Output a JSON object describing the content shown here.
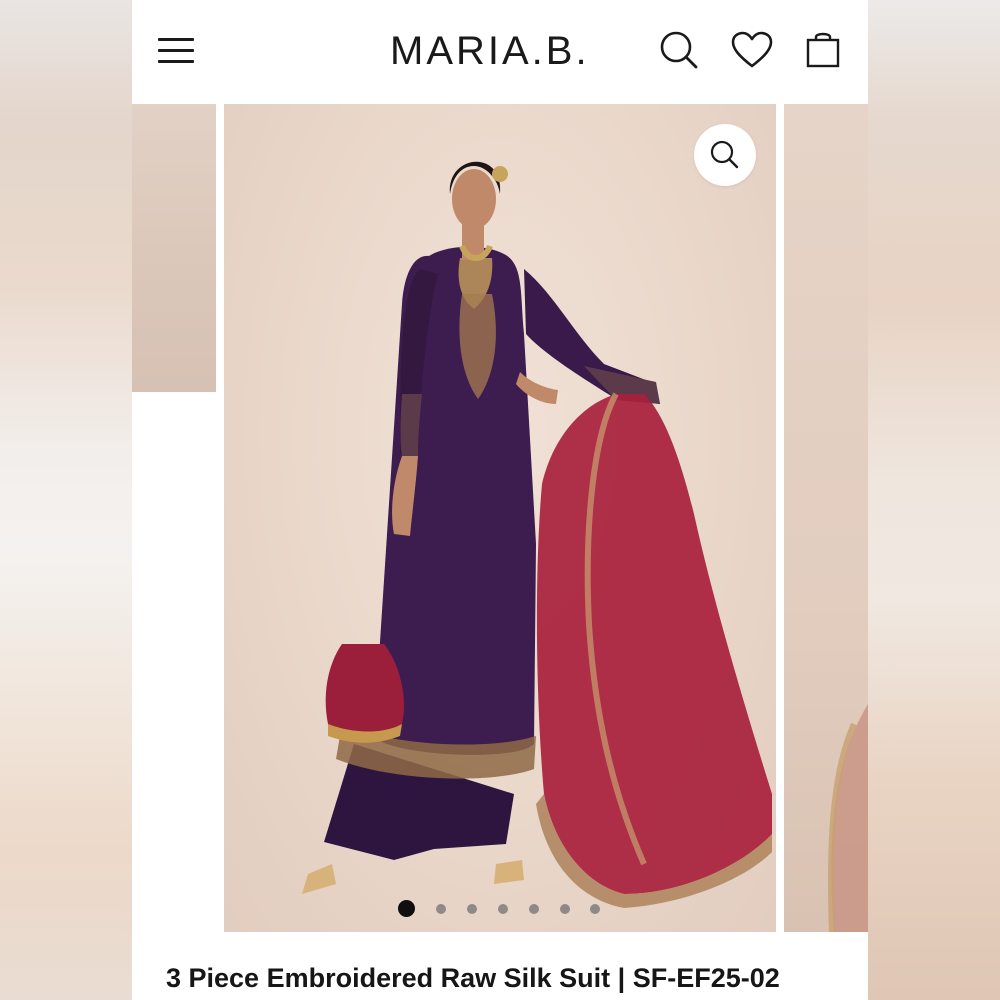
{
  "header": {
    "brand": "MARIA.B.",
    "icons": {
      "menu": "hamburger-menu-icon",
      "search": "search-icon",
      "wishlist": "heart-icon",
      "cart": "shopping-bag-icon"
    }
  },
  "gallery": {
    "zoom_icon": "zoom-icon",
    "slide_count": 7,
    "active_slide": 1,
    "image_description": "product-model-photo"
  },
  "product": {
    "title": "3 Piece Embroidered Raw Silk Suit | SF-EF25-02"
  },
  "colors": {
    "text": "#161616",
    "dress_purple": "#3d1c4f",
    "dupatta_red": "#a8203c",
    "background": "#ead8cb"
  }
}
